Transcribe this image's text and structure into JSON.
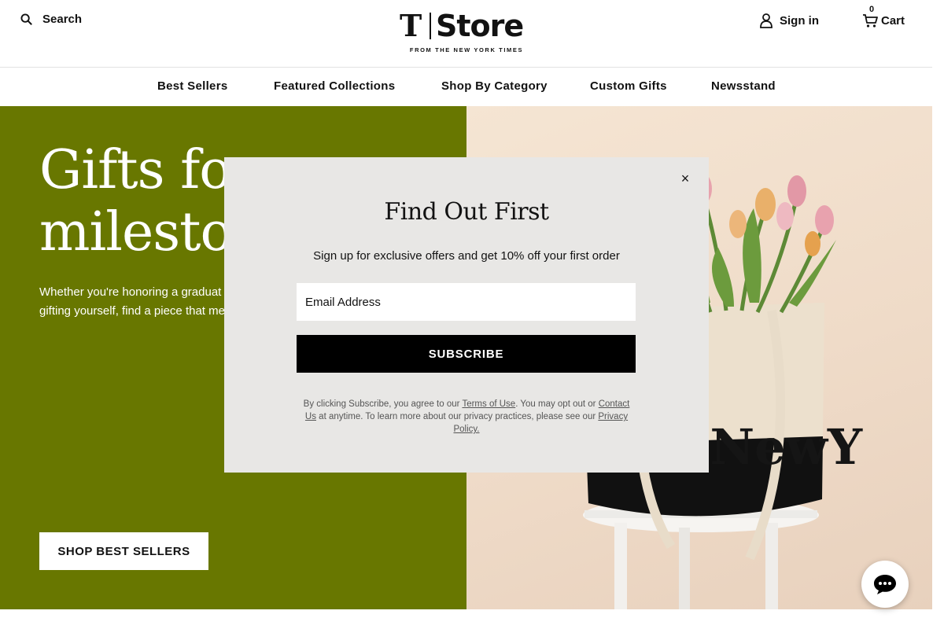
{
  "header": {
    "search_label": "Search",
    "logo_mark": "T",
    "logo_word": "Store",
    "logo_tagline": "FROM THE NEW YORK TIMES",
    "signin_label": "Sign in",
    "cart_label": "Cart",
    "cart_count": "0"
  },
  "nav": {
    "items": [
      {
        "label": "Best Sellers"
      },
      {
        "label": "Featured Collections"
      },
      {
        "label": "Shop By Category"
      },
      {
        "label": "Custom Gifts"
      },
      {
        "label": "Newsstand"
      }
    ]
  },
  "hero": {
    "title_line1": "Gifts fo",
    "title_line2": "milesto",
    "desc_line1": "Whether you're honoring a graduat",
    "desc_line2": "gifting yourself, find a piece that me",
    "button_label": "SHOP BEST SELLERS",
    "bg_color": "#687700",
    "image_bg_color": "#f0dcc8"
  },
  "modal": {
    "title": "Find Out First",
    "subtitle": "Sign up for exclusive offers and get 10% off your first order",
    "email_placeholder": "Email Address",
    "subscribe_label": "SUBSCRIBE",
    "close_symbol": "×",
    "legal_part1": "By clicking Subscribe, you agree to our ",
    "legal_terms_link": "Terms of Use",
    "legal_part2": ". You may opt out or ",
    "legal_contact_link": "Contact Us",
    "legal_part3": " at anytime. To learn more about our privacy practices, please see our ",
    "legal_privacy_link": "Privacy Policy.",
    "bg_color": "#e8e7e5"
  },
  "icons": {
    "search": "search-icon",
    "user": "user-icon",
    "cart": "cart-icon",
    "close": "close-icon",
    "chat": "chat-icon"
  }
}
